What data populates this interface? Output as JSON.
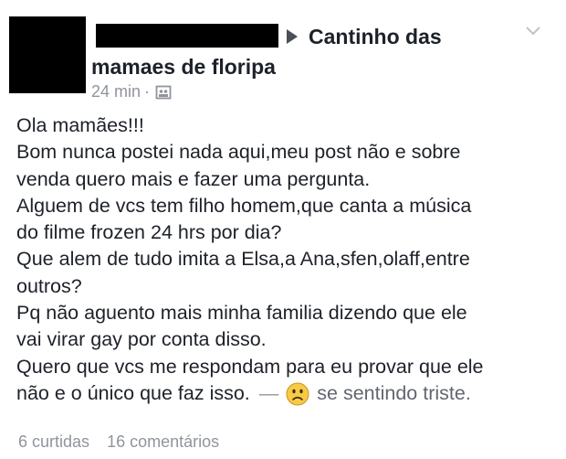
{
  "post": {
    "group_name_line1": "Cantinho das",
    "group_name_line2": "mamaes de floripa",
    "time": "24 min",
    "separator": "·",
    "icons": {
      "avatar": "profile-photo-redacted",
      "arrow": "right-triangle-icon",
      "chevron": "chevron-down-icon",
      "audience": "group-icon",
      "feeling": "sad-emoji-icon"
    },
    "body_lines": [
      "Ola mamães!!!",
      "Bom nunca postei nada aqui,meu post não e sobre",
      "venda quero mais e fazer uma pergunta.",
      "Alguem de vcs tem filho homem,que canta a música",
      "do filme frozen 24 hrs por dia?",
      "Que alem de tudo imita a Elsa,a Ana,sfen,olaff,entre",
      "outros?",
      "Pq não aguento mais minha familia dizendo que ele",
      "vai virar gay por conta disso.",
      "Quero que vcs me respondam para eu provar que ele"
    ],
    "last_line_text": "não e o único que faz isso.",
    "dash": "—",
    "feeling_text": "se sentindo triste.",
    "likes": "6 curtidas",
    "comments": "16 comentários"
  },
  "colors": {
    "text": "#1d2129",
    "meta": "#90949c",
    "emoji": "#f7c948"
  }
}
